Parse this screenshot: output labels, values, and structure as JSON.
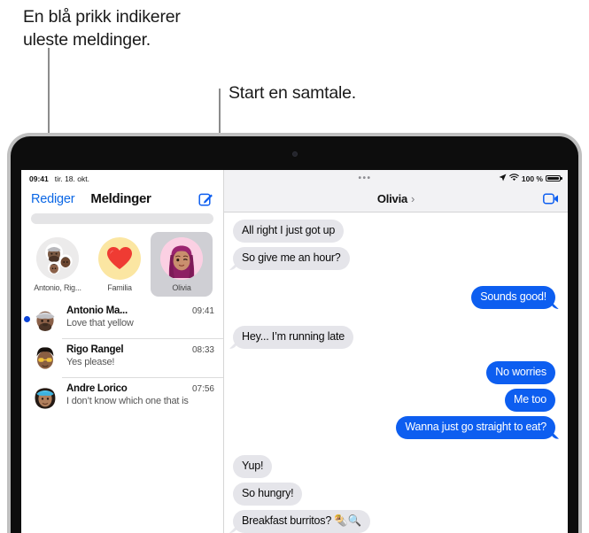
{
  "callouts": {
    "unread": "En blå prikk indikerer\nuleste meldinger.",
    "start": "Start en samtale."
  },
  "colors": {
    "accent_blue": "#0b67e5",
    "bubble_out": "#0d5ef0",
    "bubble_in": "#e5e5ea",
    "unread_dot": "#0b44d8",
    "selected_pin": "#cfcfd4"
  },
  "sidebar": {
    "status": {
      "time": "09:41",
      "date": "tir. 18. okt."
    },
    "nav": {
      "edit_label": "Rediger",
      "title": "Meldinger",
      "compose_icon": "compose-icon"
    },
    "search": {
      "placeholder": "",
      "value": ""
    },
    "pinned": [
      {
        "label": "Antonio, Rig...",
        "avatar": "group-memoji-avatar",
        "selected": false
      },
      {
        "label": "Familia",
        "avatar": "heart-emoji-avatar",
        "emoji": "❤️",
        "selected": false
      },
      {
        "label": "Olivia",
        "avatar": "olivia-memoji-avatar",
        "selected": true
      }
    ],
    "conversations": [
      {
        "name": "Antonio Ma...",
        "time": "09:41",
        "preview": "Love that yellow",
        "unread": true,
        "avatar": "antonio-memoji-avatar"
      },
      {
        "name": "Rigo Rangel",
        "time": "08:33",
        "preview": "Yes please!",
        "unread": false,
        "avatar": "rigo-memoji-avatar"
      },
      {
        "name": "Andre Lorico",
        "time": "07:56",
        "preview": "I don’t know which one that is",
        "unread": false,
        "avatar": "andre-memoji-avatar"
      }
    ]
  },
  "chat": {
    "status": {
      "multitask_dots": "•••",
      "location_icon": "location-arrow-icon",
      "wifi_icon": "wifi-icon",
      "battery_label": "100 %",
      "battery_icon": "battery-full-icon"
    },
    "nav": {
      "title": "Olivia",
      "chevron": "›",
      "facetime_icon": "facetime-video-icon"
    },
    "messages": [
      {
        "text": "All right I just got up",
        "direction": "in",
        "tail": false
      },
      {
        "text": "So give me an hour?",
        "direction": "in",
        "tail": true
      },
      {
        "text": "Sounds good!",
        "direction": "out",
        "tail": true
      },
      {
        "text": "Hey... I’m running late",
        "direction": "in",
        "tail": true
      },
      {
        "text": "No worries",
        "direction": "out",
        "tail": false
      },
      {
        "text": "Me too",
        "direction": "out",
        "tail": false
      },
      {
        "text": "Wanna just go straight to eat?",
        "direction": "out",
        "tail": true
      },
      {
        "text": "Yup!",
        "direction": "in",
        "tail": false
      },
      {
        "text": "So hungry!",
        "direction": "in",
        "tail": false
      },
      {
        "text": "Breakfast burritos? 🌯🔍",
        "direction": "in",
        "tail": true
      }
    ]
  }
}
